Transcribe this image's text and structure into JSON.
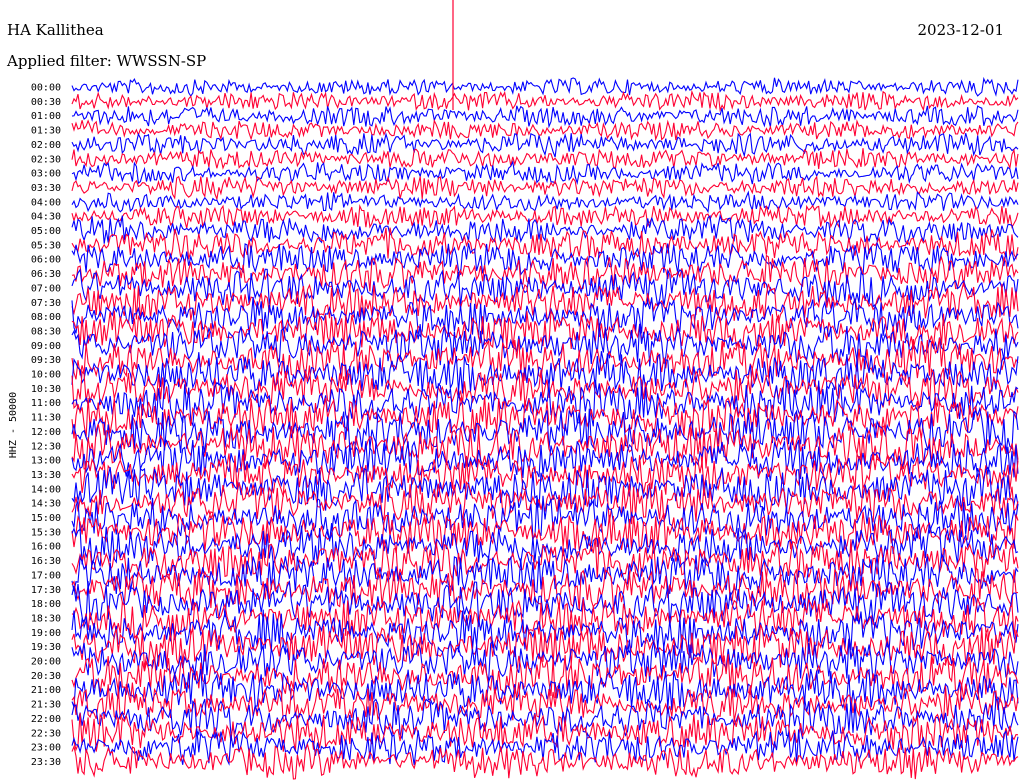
{
  "header": {
    "station": "HA Kallithea",
    "date": "2023-12-01",
    "filter": "Applied filter: WWSSN-SP"
  },
  "chart_data": {
    "type": "line",
    "title": "HA Kallithea",
    "subtitle": "Applied filter: WWSSN-SP",
    "ylabel": "HHZ - 50000",
    "xlabel": "",
    "trace_colors": [
      "#0000ff",
      "#ff0033"
    ],
    "categories": [
      "00:00",
      "00:30",
      "01:00",
      "01:30",
      "02:00",
      "02:30",
      "03:00",
      "03:30",
      "04:00",
      "04:30",
      "05:00",
      "05:30",
      "06:00",
      "06:30",
      "07:00",
      "07:30",
      "08:00",
      "08:30",
      "09:00",
      "09:30",
      "10:00",
      "10:30",
      "11:00",
      "11:30",
      "12:00",
      "12:30",
      "13:00",
      "13:30",
      "14:00",
      "14:30",
      "15:00",
      "15:30",
      "16:00",
      "16:30",
      "17:00",
      "17:30",
      "18:00",
      "18:30",
      "19:00",
      "19:30",
      "20:00",
      "20:30",
      "21:00",
      "21:30",
      "22:00",
      "22:30",
      "23:00",
      "23:30"
    ],
    "relative_amplitude": [
      0.45,
      0.5,
      0.55,
      0.5,
      0.6,
      0.55,
      0.55,
      0.6,
      0.5,
      0.6,
      0.75,
      0.8,
      0.85,
      0.9,
      0.95,
      1.0,
      1.0,
      1.0,
      1.05,
      1.05,
      1.1,
      1.1,
      1.1,
      1.1,
      1.15,
      1.15,
      1.1,
      1.1,
      1.1,
      1.1,
      1.1,
      1.1,
      1.1,
      1.1,
      1.1,
      1.1,
      1.1,
      1.1,
      1.1,
      1.1,
      1.1,
      1.1,
      1.05,
      1.05,
      1.0,
      1.0,
      0.9,
      0.85
    ],
    "grid": false,
    "legend": "none"
  }
}
